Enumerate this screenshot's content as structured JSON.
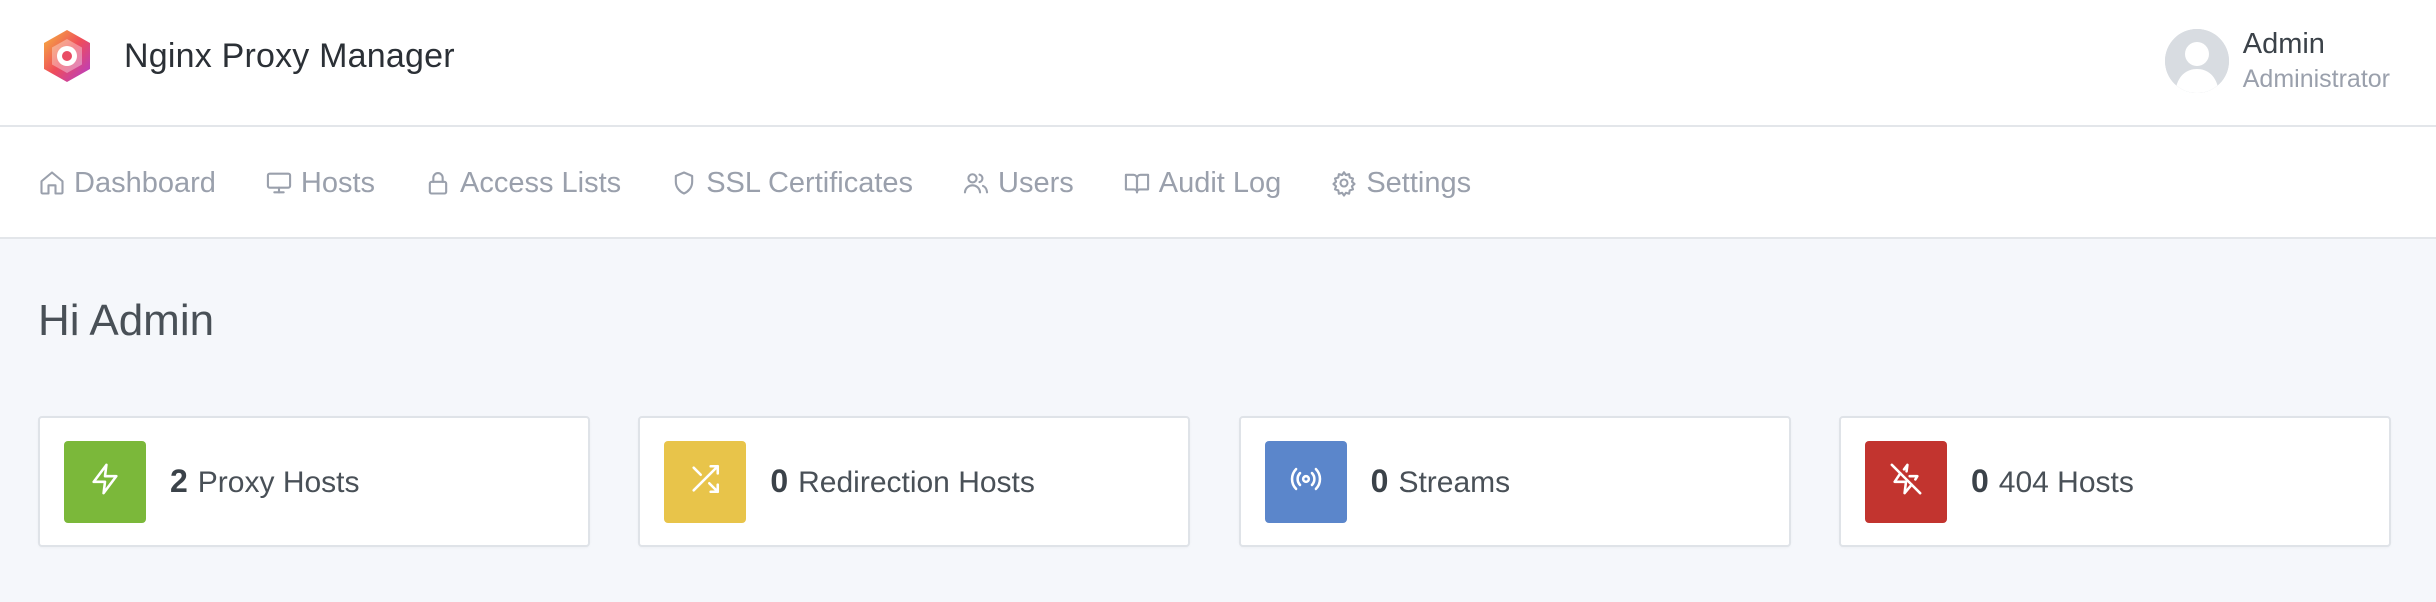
{
  "header": {
    "app_title": "Nginx Proxy Manager",
    "user": {
      "name": "Admin",
      "role": "Administrator"
    }
  },
  "nav": {
    "items": [
      {
        "label": "Dashboard",
        "icon": "home-icon"
      },
      {
        "label": "Hosts",
        "icon": "monitor-icon"
      },
      {
        "label": "Access Lists",
        "icon": "lock-icon"
      },
      {
        "label": "SSL Certificates",
        "icon": "shield-icon"
      },
      {
        "label": "Users",
        "icon": "users-icon"
      },
      {
        "label": "Audit Log",
        "icon": "book-open-icon"
      },
      {
        "label": "Settings",
        "icon": "gear-icon"
      }
    ]
  },
  "main": {
    "greeting": "Hi Admin",
    "cards": [
      {
        "count": "2",
        "label": "Proxy Hosts",
        "icon": "zap-icon",
        "color": "#7bb83a"
      },
      {
        "count": "0",
        "label": "Redirection Hosts",
        "icon": "shuffle-icon",
        "color": "#e8c44a"
      },
      {
        "count": "0",
        "label": "Streams",
        "icon": "radio-icon",
        "color": "#5b86cb"
      },
      {
        "count": "0",
        "label": "404 Hosts",
        "icon": "zap-off-icon",
        "color": "#c2342f"
      }
    ]
  }
}
